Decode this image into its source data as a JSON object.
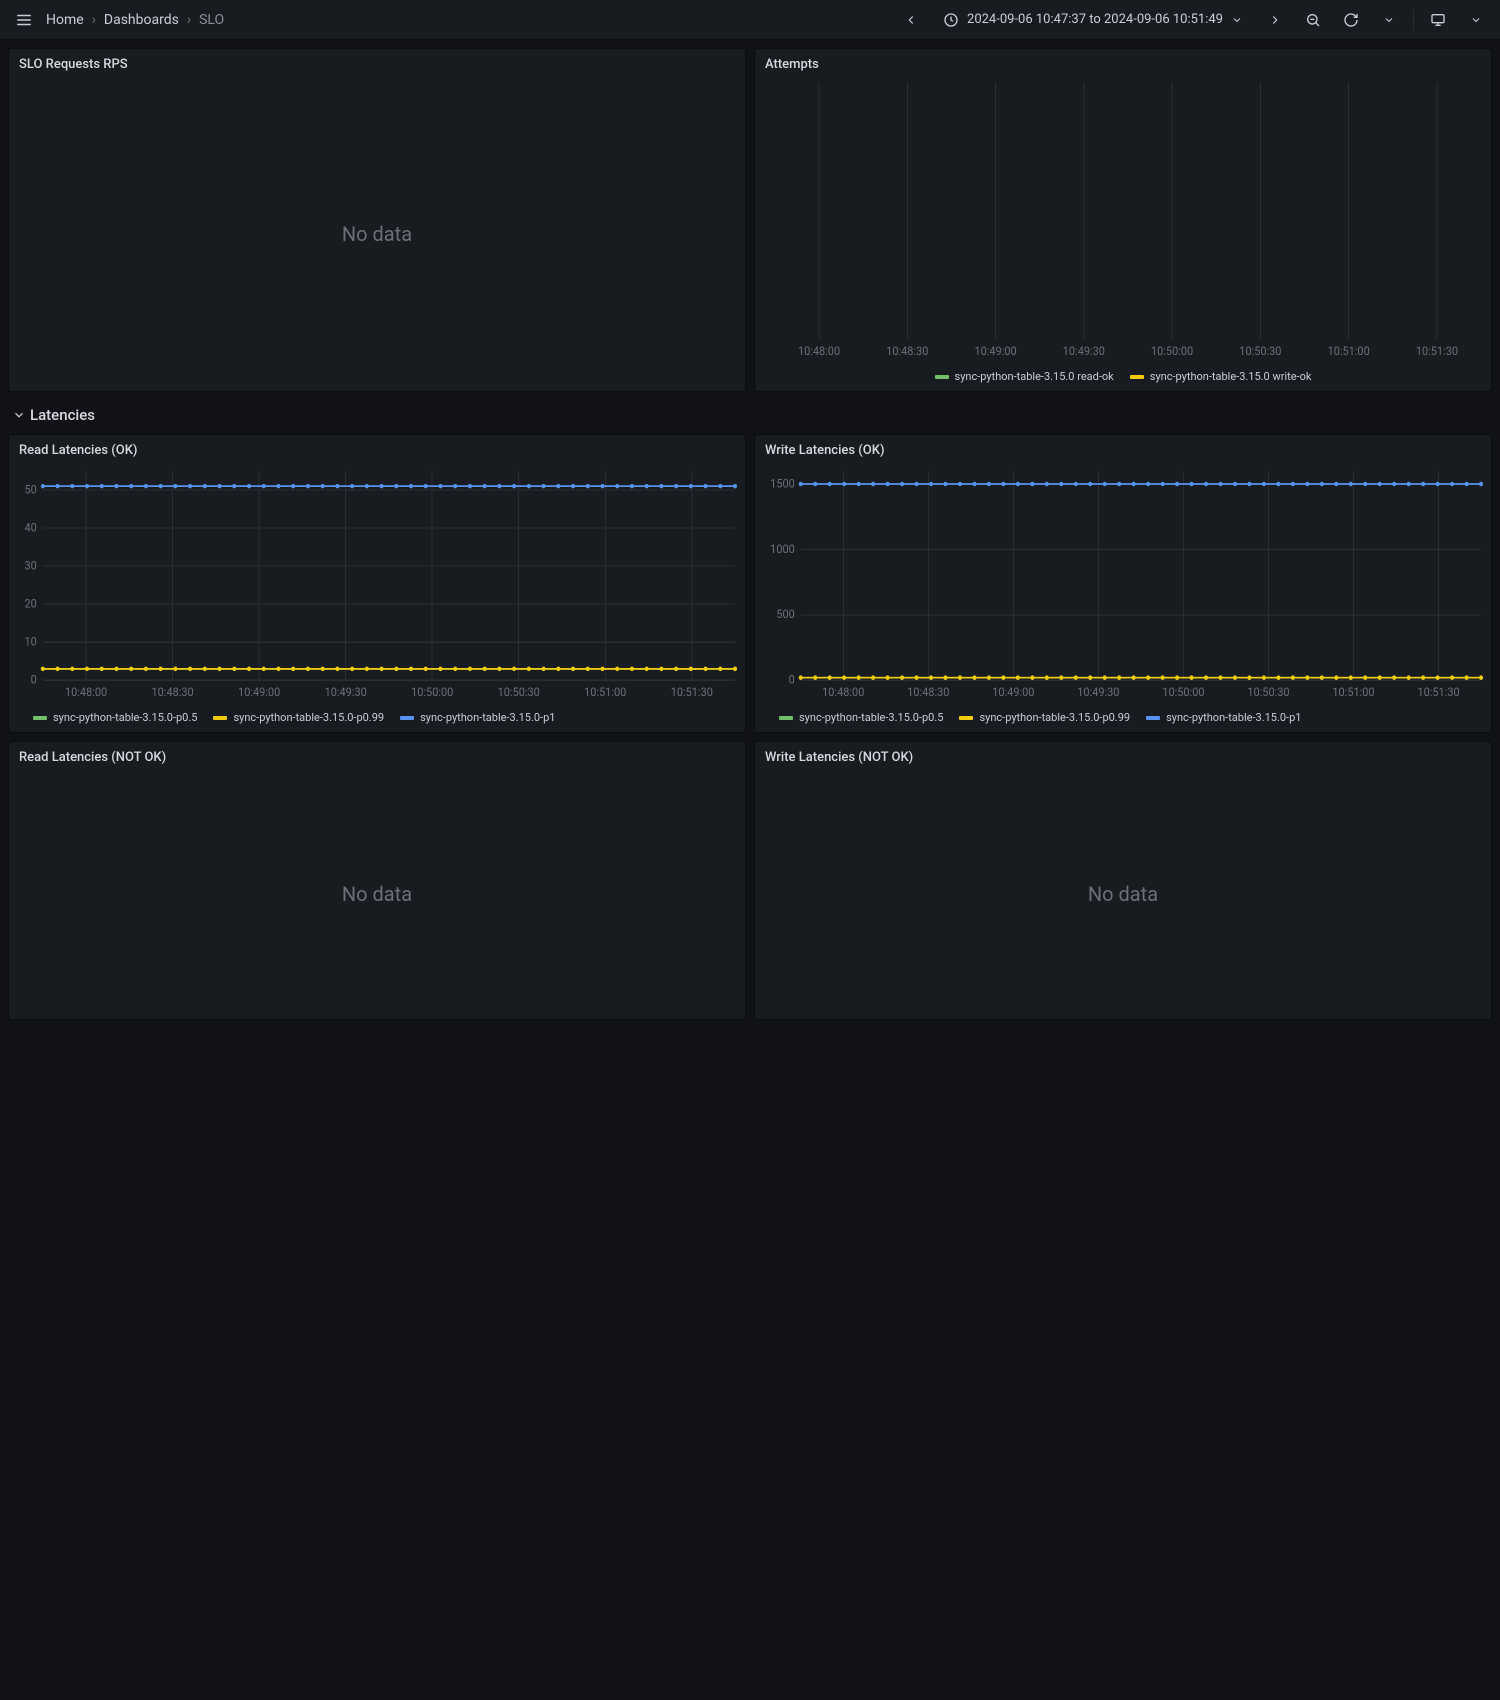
{
  "breadcrumbs": {
    "home": "Home",
    "dashboards": "Dashboards",
    "current": "SLO"
  },
  "time_range": "2024-09-06 10:47:37 to 2024-09-06 10:51:49",
  "no_data_label": "No data",
  "row_header": "Latencies",
  "panels": {
    "slo_rps": {
      "title": "SLO Requests RPS"
    },
    "attempts": {
      "title": "Attempts"
    },
    "read_ok": {
      "title": "Read Latencies (OK)"
    },
    "write_ok": {
      "title": "Write Latencies (OK)"
    },
    "read_nok": {
      "title": "Read Latencies (NOT OK)"
    },
    "write_nok": {
      "title": "Write Latencies (NOT OK)"
    }
  },
  "legends": {
    "attempts": [
      {
        "name": "sync-python-table-3.15.0 read-ok",
        "color": "#73bf69"
      },
      {
        "name": "sync-python-table-3.15.0 write-ok",
        "color": "#f2cc0c"
      }
    ],
    "latency": [
      {
        "name": "sync-python-table-3.15.0-p0.5",
        "color": "#73bf69"
      },
      {
        "name": "sync-python-table-3.15.0-p0.99",
        "color": "#f2cc0c"
      },
      {
        "name": "sync-python-table-3.15.0-p1",
        "color": "#5794f2"
      }
    ]
  },
  "x_ticks": [
    "10:48:00",
    "10:48:30",
    "10:49:00",
    "10:49:30",
    "10:50:00",
    "10:50:30",
    "10:51:00",
    "10:51:30"
  ],
  "chart_data": [
    {
      "id": "attempts",
      "type": "line",
      "title": "Attempts",
      "xlabel": "",
      "ylabel": "",
      "x_ticks": [
        "10:48:00",
        "10:48:30",
        "10:49:00",
        "10:49:30",
        "10:50:00",
        "10:50:30",
        "10:51:00",
        "10:51:30"
      ],
      "y_ticks": [],
      "ylim": [
        0,
        1
      ],
      "series": [
        {
          "name": "sync-python-table-3.15.0 read-ok",
          "color": "#73bf69",
          "values": []
        },
        {
          "name": "sync-python-table-3.15.0 write-ok",
          "color": "#f2cc0c",
          "values": []
        }
      ],
      "note": "only x gridlines visible, no data rendered"
    },
    {
      "id": "read_ok",
      "type": "line",
      "title": "Read Latencies (OK)",
      "xlabel": "",
      "ylabel": "",
      "x_ticks": [
        "10:48:00",
        "10:48:30",
        "10:49:00",
        "10:49:30",
        "10:50:00",
        "10:50:30",
        "10:51:00",
        "10:51:30"
      ],
      "y_ticks": [
        0,
        10,
        20,
        30,
        40,
        50
      ],
      "ylim": [
        0,
        55
      ],
      "series": [
        {
          "name": "sync-python-table-3.15.0-p0.5",
          "color": "#73bf69",
          "constant_value": 3
        },
        {
          "name": "sync-python-table-3.15.0-p0.99",
          "color": "#f2cc0c",
          "constant_value": 3
        },
        {
          "name": "sync-python-table-3.15.0-p1",
          "color": "#5794f2",
          "constant_value": 51
        }
      ]
    },
    {
      "id": "write_ok",
      "type": "line",
      "title": "Write Latencies (OK)",
      "xlabel": "",
      "ylabel": "",
      "x_ticks": [
        "10:48:00",
        "10:48:30",
        "10:49:00",
        "10:49:30",
        "10:50:00",
        "10:50:30",
        "10:51:00",
        "10:51:30"
      ],
      "y_ticks": [
        0,
        500,
        1000,
        1500
      ],
      "ylim": [
        0,
        1600
      ],
      "series": [
        {
          "name": "sync-python-table-3.15.0-p0.5",
          "color": "#73bf69",
          "constant_value": 20
        },
        {
          "name": "sync-python-table-3.15.0-p0.99",
          "color": "#f2cc0c",
          "constant_value": 20
        },
        {
          "name": "sync-python-table-3.15.0-p1",
          "color": "#5794f2",
          "constant_value": 1500
        }
      ]
    },
    {
      "id": "read_nok",
      "type": "line",
      "title": "Read Latencies (NOT OK)",
      "series": [],
      "note": "No data"
    },
    {
      "id": "write_nok",
      "type": "line",
      "title": "Write Latencies (NOT OK)",
      "series": [],
      "note": "No data"
    }
  ]
}
